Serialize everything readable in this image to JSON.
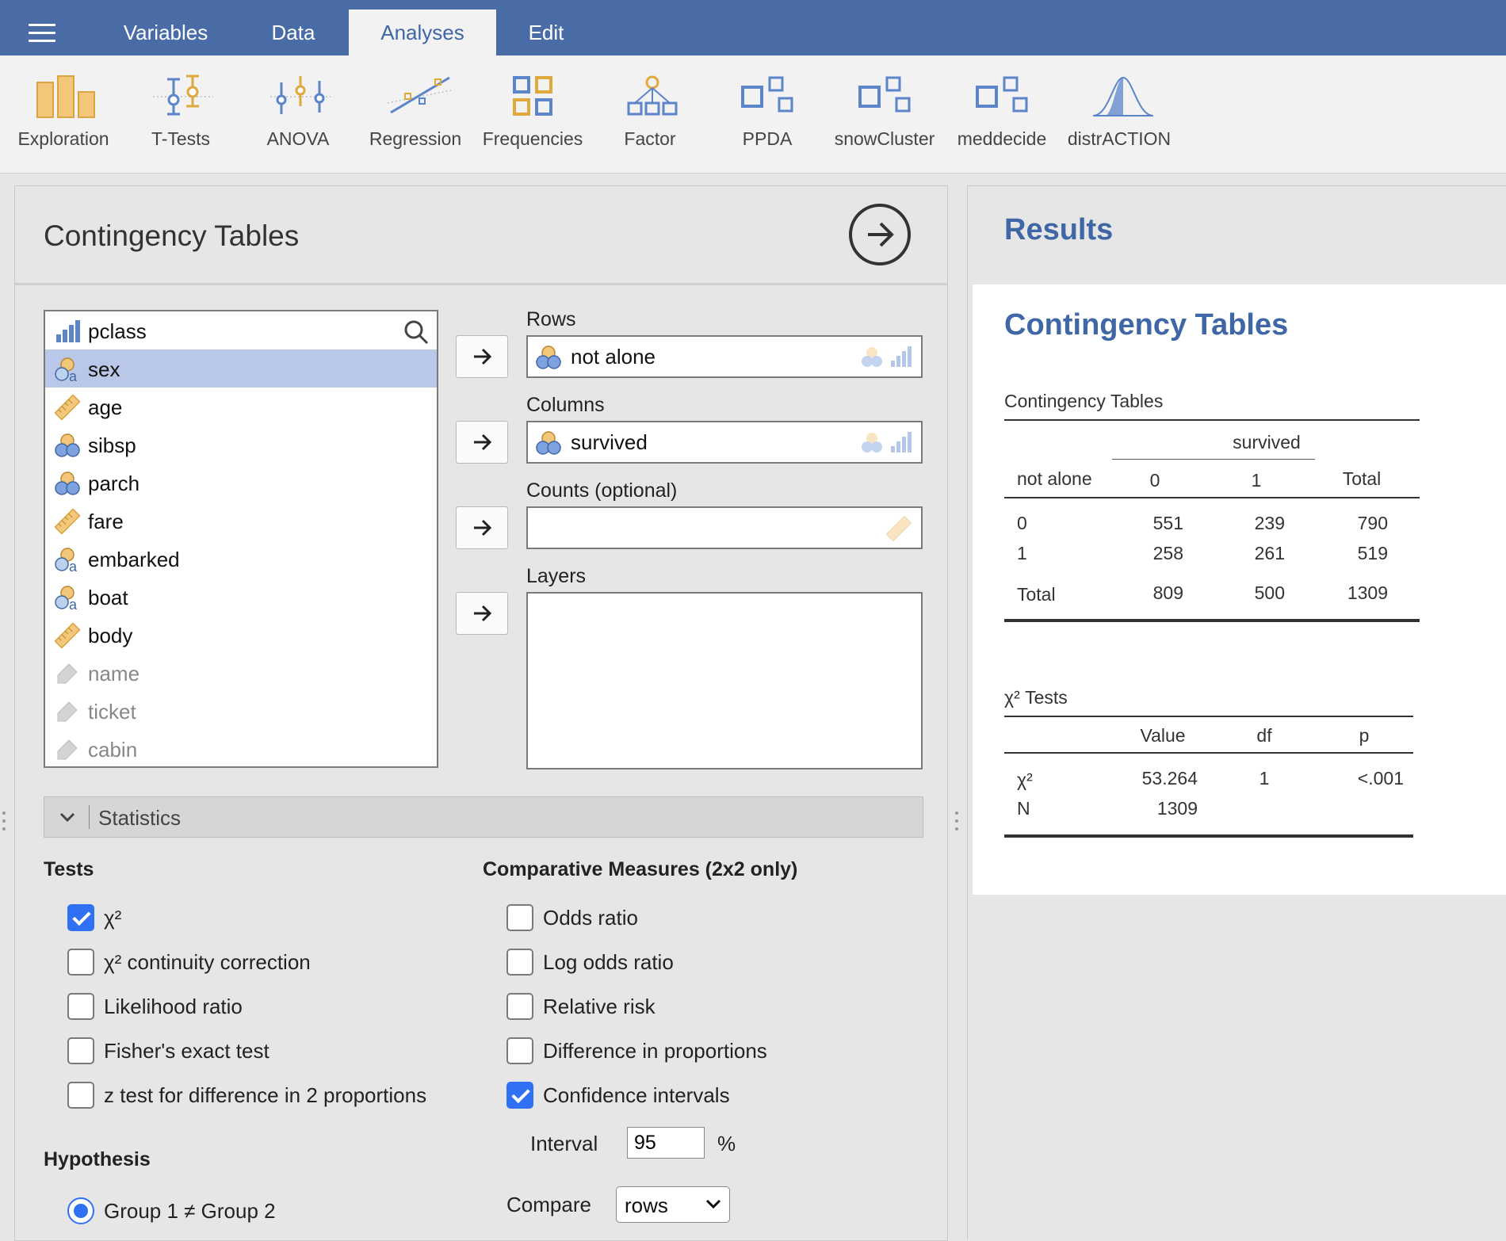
{
  "menu": {
    "tabs": [
      {
        "label": "Variables"
      },
      {
        "label": "Data"
      },
      {
        "label": "Analyses"
      },
      {
        "label": "Edit"
      }
    ]
  },
  "ribbon": {
    "tools": [
      {
        "label": "Exploration",
        "icon": "exploration-icon"
      },
      {
        "label": "T-Tests",
        "icon": "t-tests-icon"
      },
      {
        "label": "ANOVA",
        "icon": "anova-icon"
      },
      {
        "label": "Regression",
        "icon": "regression-icon"
      },
      {
        "label": "Frequencies",
        "icon": "frequencies-icon"
      },
      {
        "label": "Factor",
        "icon": "factor-icon"
      },
      {
        "label": "PPDA",
        "icon": "module-icon"
      },
      {
        "label": "snowCluster",
        "icon": "module-icon"
      },
      {
        "label": "meddecide",
        "icon": "module-icon"
      },
      {
        "label": "distrACTION",
        "icon": "distribution-icon"
      }
    ]
  },
  "options": {
    "title": "Contingency Tables",
    "variables": [
      {
        "label": "pclass",
        "type": "ordinal"
      },
      {
        "label": "sex",
        "type": "nominal-text",
        "selected": true
      },
      {
        "label": "age",
        "type": "continuous"
      },
      {
        "label": "sibsp",
        "type": "nominal"
      },
      {
        "label": "parch",
        "type": "nominal"
      },
      {
        "label": "fare",
        "type": "continuous"
      },
      {
        "label": "embarked",
        "type": "nominal-text"
      },
      {
        "label": "boat",
        "type": "nominal-text"
      },
      {
        "label": "body",
        "type": "continuous"
      },
      {
        "label": "name",
        "type": "id"
      },
      {
        "label": "ticket",
        "type": "id"
      },
      {
        "label": "cabin",
        "type": "id"
      }
    ],
    "rows_label": "Rows",
    "rows_value": "not alone",
    "columns_label": "Columns",
    "columns_value": "survived",
    "counts_label": "Counts (optional)",
    "layers_label": "Layers",
    "statistics_section": "Statistics",
    "tests_heading": "Tests",
    "tests": [
      {
        "label": "χ²",
        "checked": true
      },
      {
        "label": "χ² continuity correction",
        "checked": false
      },
      {
        "label": "Likelihood ratio",
        "checked": false
      },
      {
        "label": "Fisher's exact test",
        "checked": false
      },
      {
        "label": "z test for difference in 2 proportions",
        "checked": false
      }
    ],
    "comparative_heading": "Comparative Measures (2x2 only)",
    "comparative": [
      {
        "label": "Odds ratio",
        "checked": false
      },
      {
        "label": "Log odds ratio",
        "checked": false
      },
      {
        "label": "Relative risk",
        "checked": false
      },
      {
        "label": "Difference in proportions",
        "checked": false
      },
      {
        "label": "Confidence intervals",
        "checked": true
      }
    ],
    "interval_label": "Interval",
    "interval_value": "95",
    "interval_unit": "%",
    "compare_label": "Compare",
    "compare_value": "rows",
    "hypothesis_heading": "Hypothesis",
    "hypothesis_option": "Group 1 ≠ Group 2"
  },
  "results": {
    "heading": "Results",
    "analysis_title": "Contingency Tables",
    "contingency": {
      "title": "Contingency Tables",
      "column_group": "survived",
      "row_var": "not alone",
      "col_headers": [
        "0",
        "1",
        "Total"
      ],
      "rows": [
        {
          "label": "0",
          "values": [
            "551",
            "239",
            "790"
          ]
        },
        {
          "label": "1",
          "values": [
            "258",
            "261",
            "519"
          ]
        },
        {
          "label": "Total",
          "values": [
            "809",
            "500",
            "1309"
          ]
        }
      ]
    },
    "chi_tests": {
      "title": "χ² Tests",
      "headers": [
        "Value",
        "df",
        "p"
      ],
      "rows": [
        {
          "label": "χ²",
          "value": "53.264",
          "df": "1",
          "p": "<.001"
        },
        {
          "label": "N",
          "value": "1309",
          "df": "",
          "p": ""
        }
      ]
    }
  },
  "colors": {
    "menubar": "#4a6ca6",
    "accent": "#3f67a6",
    "checkbox": "#2f71f2",
    "selected_row": "#b9c8e8"
  }
}
